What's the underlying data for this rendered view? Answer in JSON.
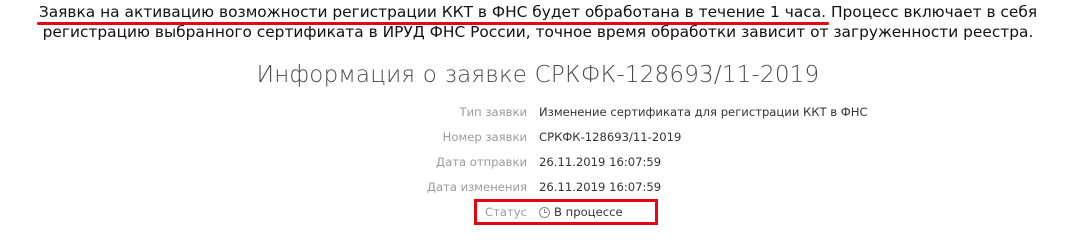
{
  "notice": {
    "line1_highlight": "Заявка на активацию возможности регистрации ККТ в ФНС будет обработана в течение 1 часа.",
    "line1_rest": " Процесс включает в себя",
    "line2": "регистрацию выбранного сертификата в ИРУД ФНС России, точное время обработки зависит от загруженности реестра.",
    "highlight_color": "#e30613"
  },
  "title": "Информация о заявке СРКФК-128693/11-2019",
  "details": [
    {
      "label": "Тип заявки",
      "value": "Изменение сертификата для регистрации ККТ в ФНС"
    },
    {
      "label": "Номер заявки",
      "value": "СРКФК-128693/11-2019"
    },
    {
      "label": "Дата отправки",
      "value": "26.11.2019 16:07:59"
    },
    {
      "label": "Дата изменения",
      "value": "26.11.2019 16:07:59"
    }
  ],
  "status": {
    "label": "Статус",
    "value": "В процессе",
    "icon": "clock-icon",
    "highlight_color": "#e30613"
  }
}
